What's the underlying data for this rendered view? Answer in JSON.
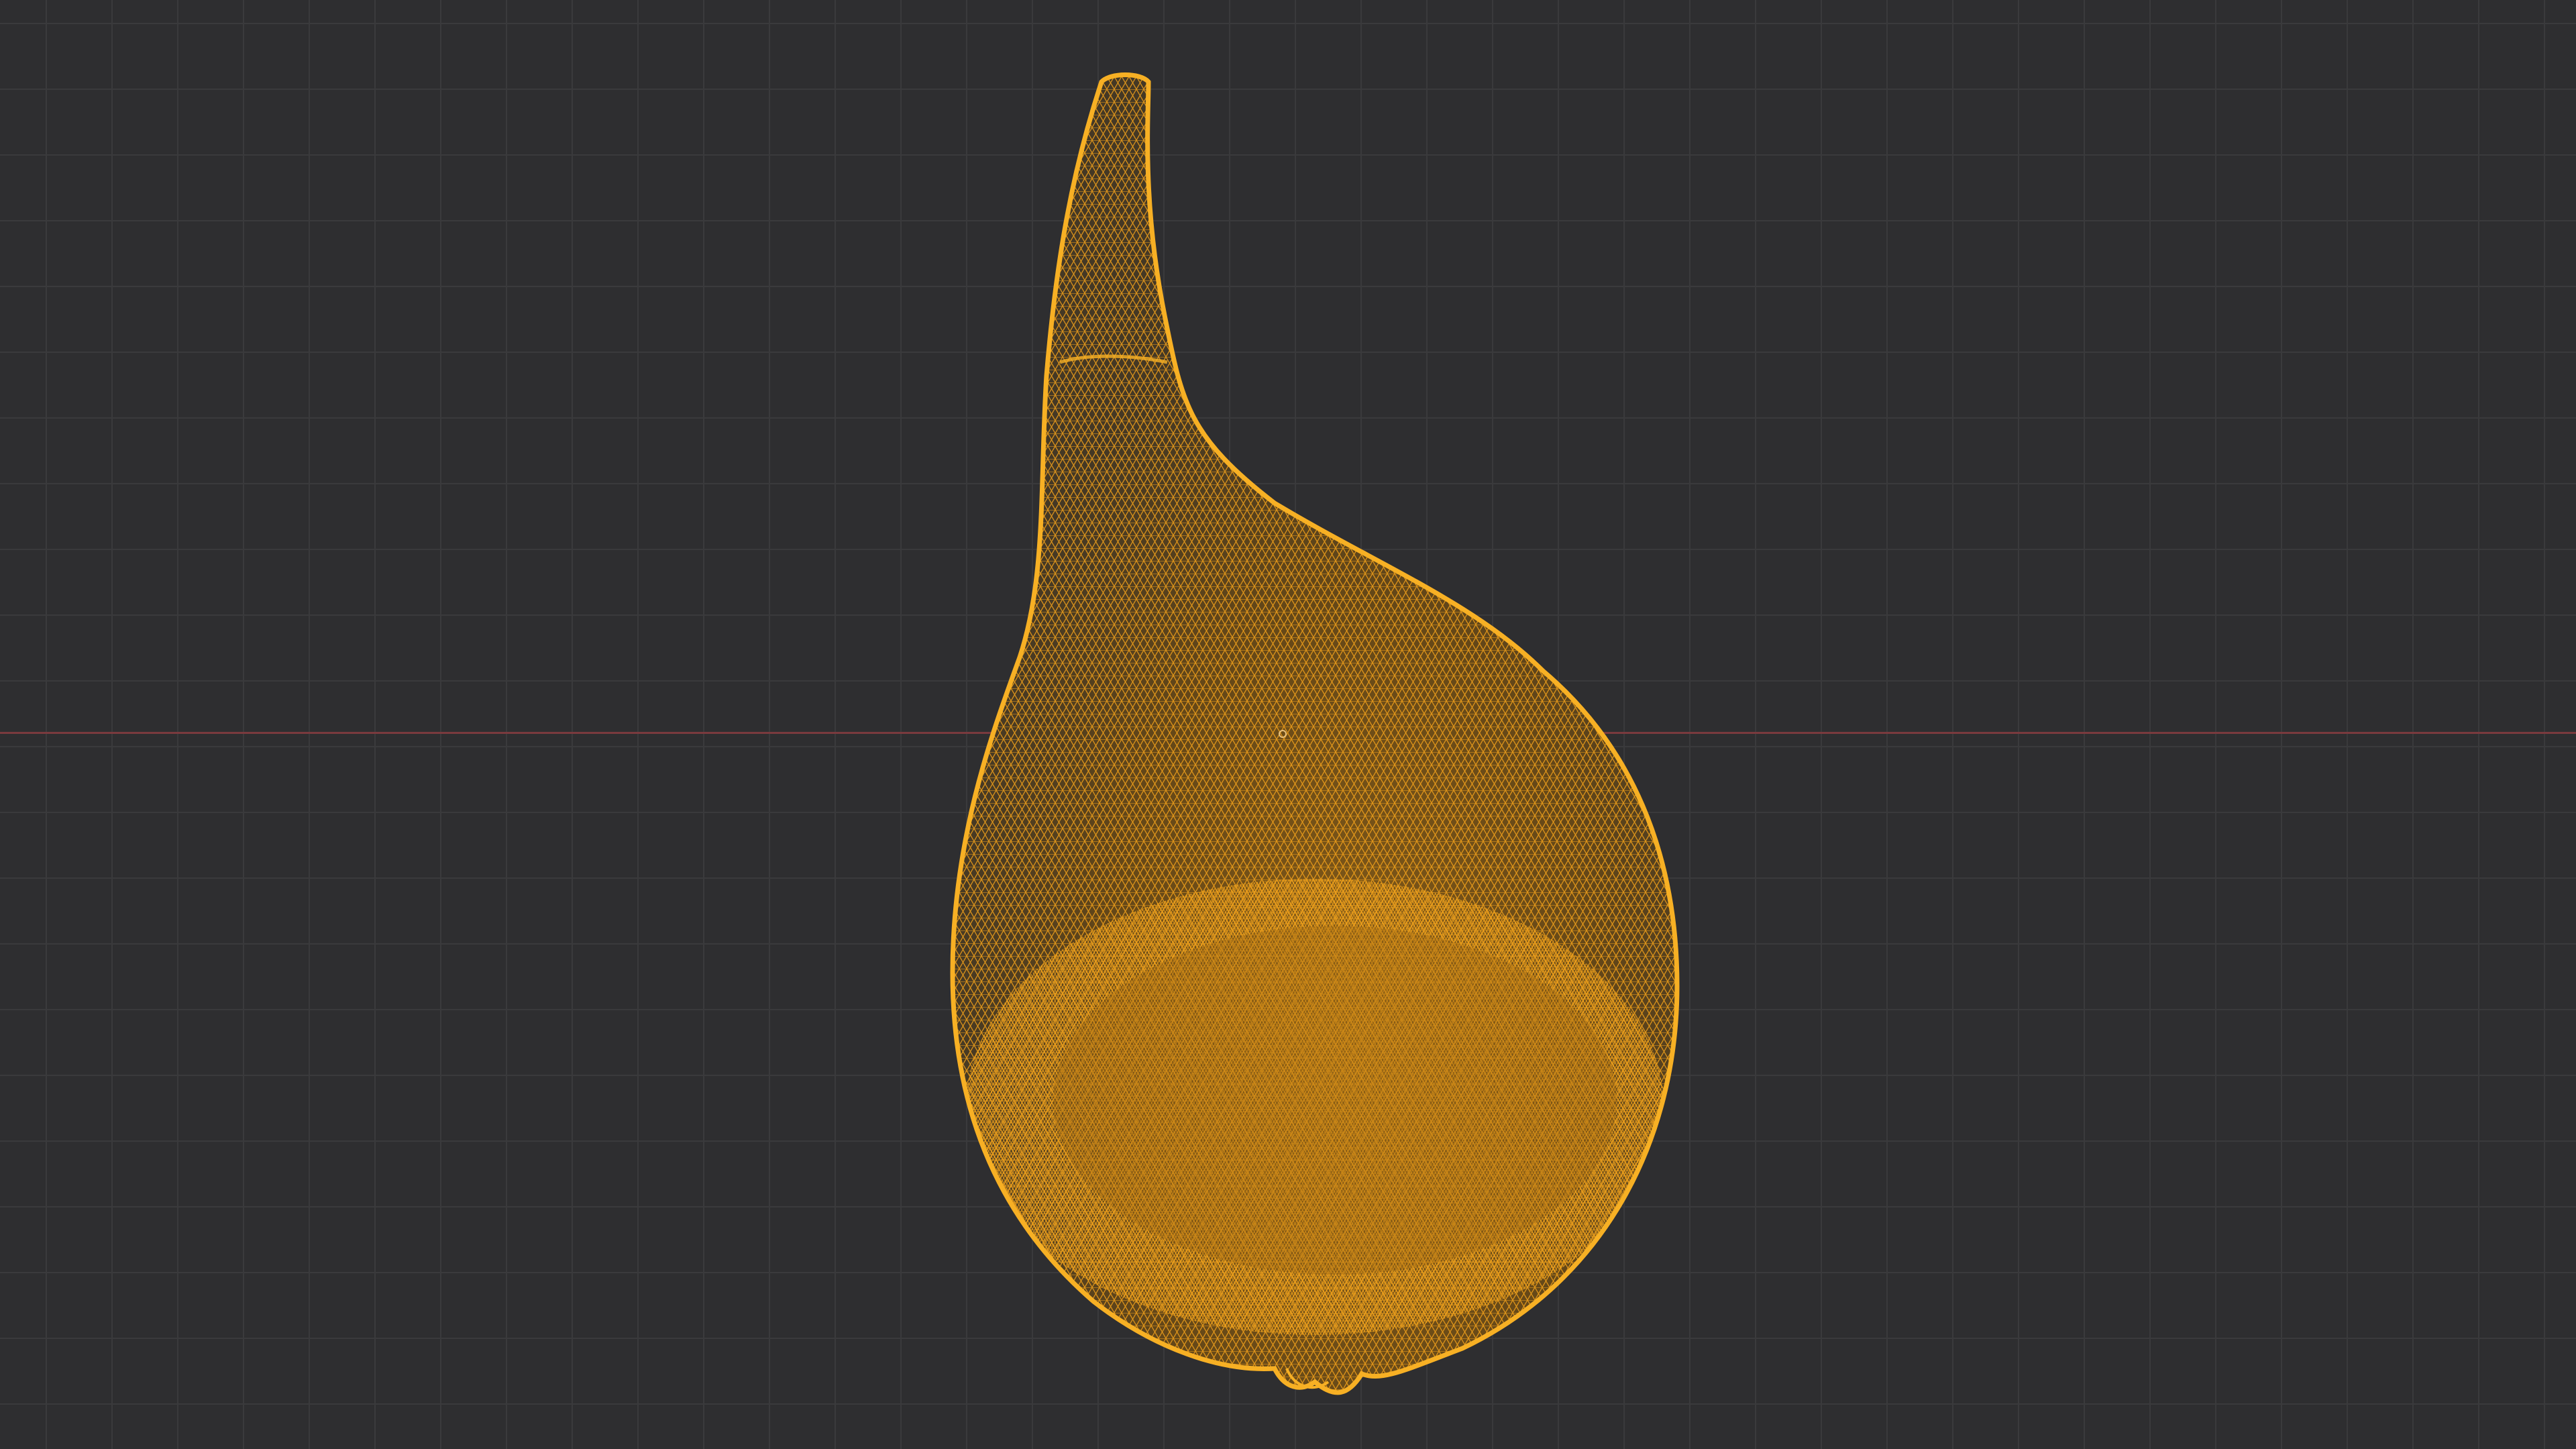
{
  "viewport": {
    "background_color": "#2e2e30",
    "grid_color": "#3a3a3c",
    "x_axis_color": "#7a3a3e"
  },
  "mesh": {
    "display_mode": "wireframe",
    "selected": true,
    "wire_color": "#f2a11a",
    "fill_color": "#7a5415"
  },
  "icons": {
    "origin": "object-origin-icon"
  }
}
